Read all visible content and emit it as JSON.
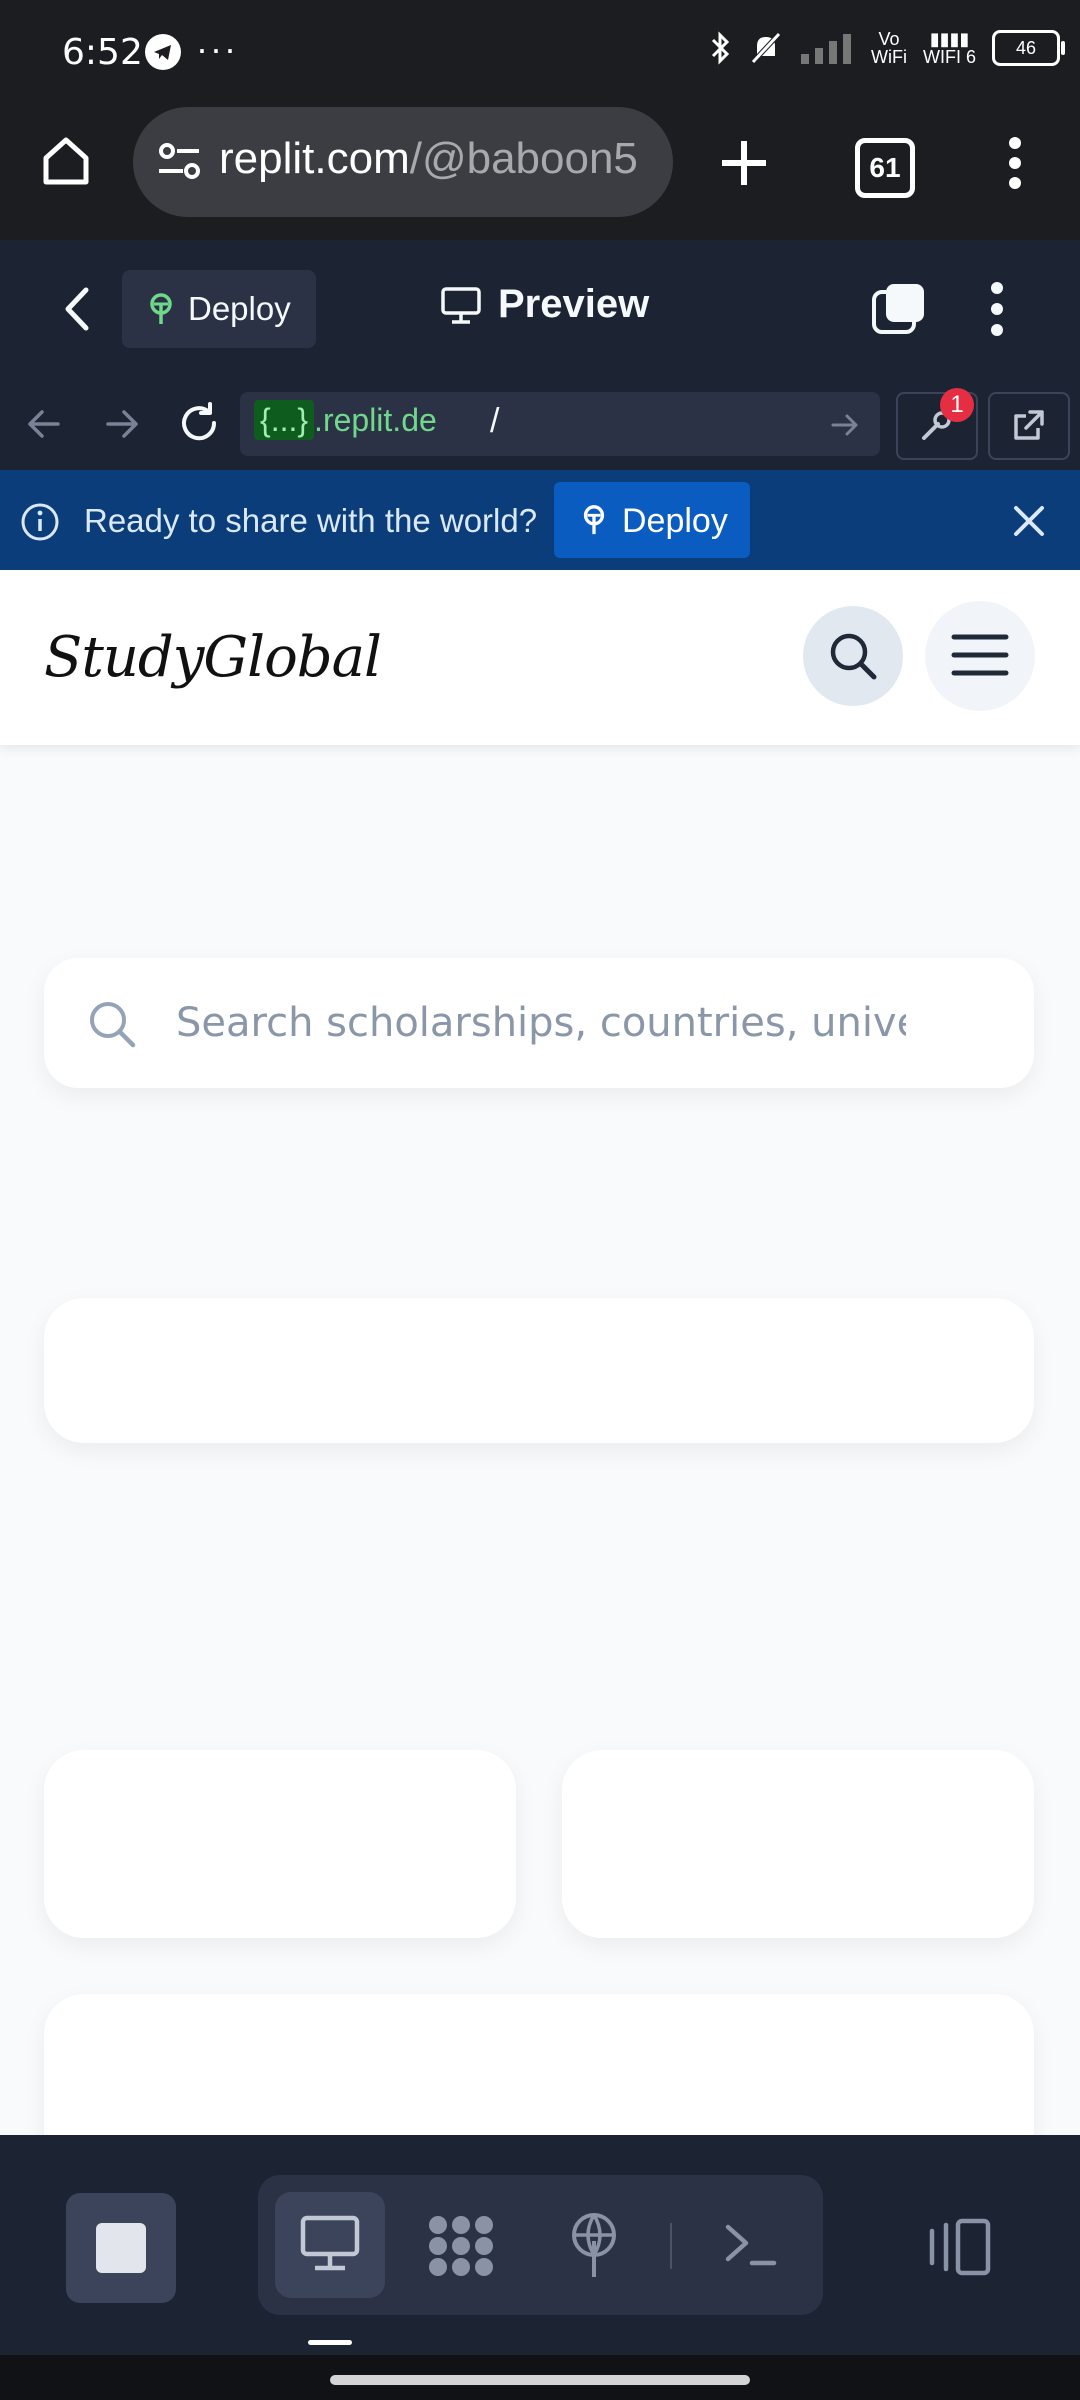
{
  "status_bar": {
    "time": "6:52",
    "more": "···",
    "network_label_top": "Vo",
    "network_label_bottom": "WiFi",
    "wifi_label": "WIFI 6",
    "battery": "46"
  },
  "browser": {
    "url_host": "replit.com",
    "url_path": "/@baboon5",
    "tab_count": "61",
    "icons": [
      "home-icon",
      "site-settings-icon",
      "new-tab-icon",
      "tabs-icon",
      "menu-icon"
    ]
  },
  "replit_header": {
    "deploy_label": "Deploy",
    "preview_label": "Preview"
  },
  "replit_urlbar": {
    "host_prefix": "{...}",
    "host_suffix": ".replit.de",
    "path": "/",
    "badge_count": "1"
  },
  "banner": {
    "text": "Ready to share with the world?",
    "button_label": "Deploy"
  },
  "webpage": {
    "logo": "StudyGlobal",
    "search_placeholder": "Search scholarships, countries, univer"
  },
  "colors": {
    "replit_bg": "#1c2333",
    "banner_bg": "#0a3d7a",
    "banner_button": "#0b5cc1",
    "deploy_green": "#6fd88b",
    "badge_red": "#e52e41"
  }
}
